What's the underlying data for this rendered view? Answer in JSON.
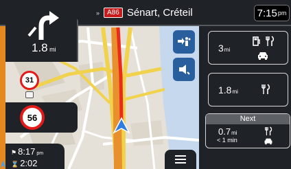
{
  "next_turn": {
    "distance": "1.8",
    "unit": "mi",
    "icon": "turn-left-arrow-icon"
  },
  "route": {
    "road_number": "A86",
    "street_name": "Sénart, Créteil"
  },
  "clock": {
    "time": "7:15",
    "period": "pm"
  },
  "speed_limits": {
    "secondary": "31",
    "current": "56"
  },
  "services": [
    {
      "distance": "3",
      "unit": "mi",
      "icons": [
        "fuel-icon",
        "restaurant-icon",
        "car-service-icon"
      ]
    },
    {
      "distance": "1.8",
      "unit": "mi",
      "icons": [
        "restaurant-icon"
      ]
    }
  ],
  "next_service": {
    "title": "Next",
    "distance": "0.7",
    "unit": "mi",
    "time": "< 1 min",
    "icons": [
      "restaurant-icon",
      "car-service-icon"
    ]
  },
  "trip": {
    "arrival_time": "8:17",
    "arrival_period": "pm",
    "remaining_time": "2:02"
  },
  "colors": {
    "panel": "#1f2328",
    "accent_orange": "#e4891f",
    "map_button": "#2a5f9e",
    "speed_red": "#e21a1a",
    "road_badge": "#c71a1a",
    "vehicle": "#2f7de1"
  }
}
